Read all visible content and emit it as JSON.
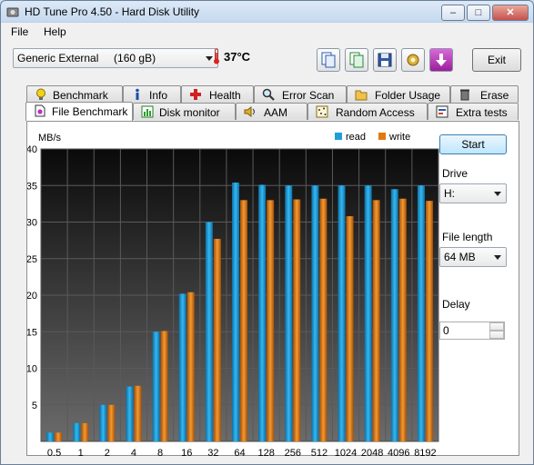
{
  "window": {
    "title": "HD Tune Pro 4.50 - Hard Disk Utility"
  },
  "menu": {
    "file": "File",
    "help": "Help"
  },
  "toolbar": {
    "drive_select": "Generic External     (160 gB)",
    "temperature": "37°C",
    "exit_label": "Exit"
  },
  "tabs_top": [
    "Benchmark",
    "Info",
    "Health",
    "Error Scan",
    "Folder Usage",
    "Erase"
  ],
  "tabs_bottom": [
    "File Benchmark",
    "Disk monitor",
    "AAM",
    "Random Access",
    "Extra tests"
  ],
  "side": {
    "start_label": "Start",
    "drive_label": "Drive",
    "drive_value": "H:",
    "file_length_label": "File length",
    "file_length_value": "64 MB",
    "delay_label": "Delay",
    "delay_value": "0"
  },
  "chart_data": {
    "type": "bar",
    "ylabel": "MB/s",
    "ylim": [
      0,
      40
    ],
    "yticks": [
      5,
      10,
      15,
      20,
      25,
      30,
      35,
      40
    ],
    "categories": [
      "0.5",
      "1",
      "2",
      "4",
      "8",
      "16",
      "32",
      "64",
      "128",
      "256",
      "512",
      "1024",
      "2048",
      "4096",
      "8192"
    ],
    "series": [
      {
        "name": "read",
        "color": "#1e9fd8",
        "values": [
          1.2,
          2.5,
          5.0,
          7.5,
          15.0,
          20.2,
          30.0,
          35.4,
          35.1,
          35.0,
          35.0,
          35.0,
          35.0,
          34.5,
          35.0
        ]
      },
      {
        "name": "write",
        "color": "#e07a10",
        "values": [
          1.2,
          2.5,
          5.0,
          7.6,
          15.1,
          20.4,
          27.7,
          33.0,
          33.0,
          33.1,
          33.2,
          30.8,
          33.0,
          33.2,
          32.9
        ]
      }
    ],
    "grid": true,
    "legend": "top-right"
  }
}
